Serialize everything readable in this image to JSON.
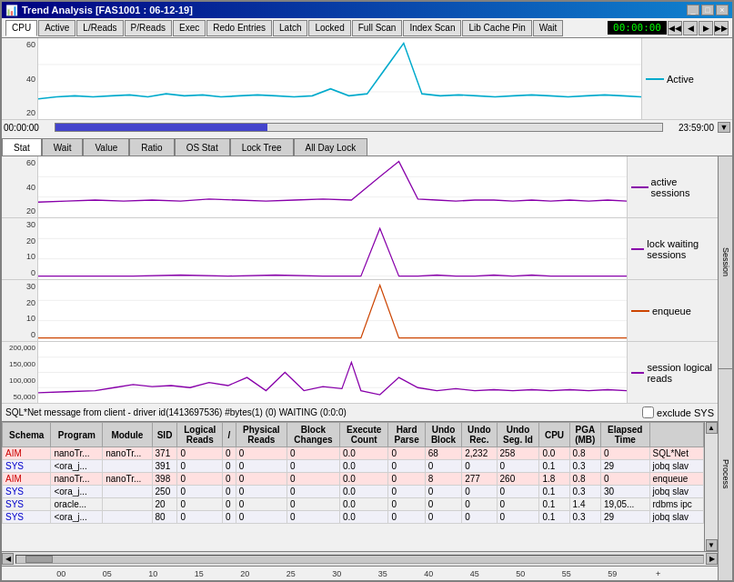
{
  "window": {
    "title": "Trend Analysis [FAS1001 : 06-12-19]",
    "title_icon": "chart-icon"
  },
  "toolbar": {
    "tabs": [
      {
        "label": "CPU",
        "active": true
      },
      {
        "label": "Active",
        "active": false
      },
      {
        "label": "L/Reads",
        "active": false
      },
      {
        "label": "P/Reads",
        "active": false
      },
      {
        "label": "Exec",
        "active": false
      },
      {
        "label": "Redo Entries",
        "active": false
      },
      {
        "label": "Latch",
        "active": false
      },
      {
        "label": "Locked",
        "active": false
      },
      {
        "label": "Full Scan",
        "active": false
      },
      {
        "label": "Index Scan",
        "active": false
      },
      {
        "label": "Lib Cache Pin",
        "active": false
      },
      {
        "label": "Wait",
        "active": false
      }
    ],
    "timer": "00:00:00"
  },
  "progress": {
    "start": "00:00:00",
    "end": "23:59:00"
  },
  "chart_tabs": [
    {
      "label": "Stat",
      "active": true
    },
    {
      "label": "Wait",
      "active": false
    },
    {
      "label": "Value",
      "active": false
    },
    {
      "label": "Ratio",
      "active": false
    },
    {
      "label": "OS Stat",
      "active": false
    },
    {
      "label": "Lock Tree",
      "active": false
    },
    {
      "label": "All Day Lock",
      "active": false
    }
  ],
  "charts": {
    "active": {
      "legend": "Active",
      "color": "#00aacc",
      "y_labels": [
        "60",
        "40",
        "20"
      ]
    },
    "active_sessions": {
      "legend": "active sessions",
      "color": "#8800aa",
      "y_labels": [
        "60",
        "40",
        "20"
      ]
    },
    "lock_waiting": {
      "legend": "lock waiting sessions",
      "color": "#8800aa",
      "y_labels": [
        "30",
        "20",
        "10",
        "0"
      ]
    },
    "enqueue": {
      "legend": "enqueue",
      "color": "#cc4400",
      "y_labels": [
        "30",
        "20",
        "10",
        "0"
      ]
    },
    "session_logical": {
      "legend": "session logical reads",
      "color": "#8800aa",
      "y_labels": [
        "200,000",
        "150,000",
        "100,000",
        "50,000"
      ]
    }
  },
  "session_bar": {
    "text": "SQL*Net message from client - driver id(1413697536) #bytes(1) (0) WAITING (0:0:0)",
    "exclude_sys_label": "exclude SYS"
  },
  "table": {
    "columns": [
      "Schema",
      "Program",
      "Module",
      "SID",
      "Logical Reads",
      "/",
      "Physical Reads",
      "Block Changes",
      "Execute Count",
      "Hard Parse",
      "Undo Block",
      "Undo Rec.",
      "Undo Seg. Id",
      "CPU",
      "PGA (MB)",
      "Elapsed Time",
      ""
    ],
    "rows": [
      {
        "schema": "AIM",
        "program": "nanoTr...",
        "module": "nanoTr...",
        "sid": "371",
        "logical_reads": "0",
        "slash": "0",
        "physical_reads": "0",
        "block_changes": "0",
        "execute_count": "0.0",
        "hard_parse": "0",
        "undo_block": "68",
        "undo_rec": "2,232",
        "undo_seg": "258",
        "cpu": "0.0",
        "pga": "0.8",
        "elapsed": "0",
        "extra": "SQL*Net",
        "type": "aim"
      },
      {
        "schema": "SYS",
        "program": "<ora_j...",
        "module": "",
        "sid": "391",
        "logical_reads": "0",
        "slash": "0",
        "physical_reads": "0",
        "block_changes": "0",
        "execute_count": "0.0",
        "hard_parse": "0",
        "undo_block": "0",
        "undo_rec": "0",
        "undo_seg": "0",
        "cpu": "0.1",
        "pga": "0.3",
        "elapsed": "29",
        "extra": "jobq slav",
        "type": "sys"
      },
      {
        "schema": "AIM",
        "program": "nanoTr...",
        "module": "nanoTr...",
        "sid": "398",
        "logical_reads": "0",
        "slash": "0",
        "physical_reads": "0",
        "block_changes": "0",
        "execute_count": "0.0",
        "hard_parse": "0",
        "undo_block": "8",
        "undo_rec": "277",
        "undo_seg": "260",
        "cpu": "1.8",
        "pga": "0.8",
        "elapsed": "0",
        "extra": "enqueue",
        "type": "aim"
      },
      {
        "schema": "SYS",
        "program": "<ora_j...",
        "module": "",
        "sid": "250",
        "logical_reads": "0",
        "slash": "0",
        "physical_reads": "0",
        "block_changes": "0",
        "execute_count": "0.0",
        "hard_parse": "0",
        "undo_block": "0",
        "undo_rec": "0",
        "undo_seg": "0",
        "cpu": "0.1",
        "pga": "0.3",
        "elapsed": "30",
        "extra": "jobq slav",
        "type": "sys"
      },
      {
        "schema": "SYS",
        "program": "oracle...",
        "module": "",
        "sid": "20",
        "logical_reads": "0",
        "slash": "0",
        "physical_reads": "0",
        "block_changes": "0",
        "execute_count": "0.0",
        "hard_parse": "0",
        "undo_block": "0",
        "undo_rec": "0",
        "undo_seg": "0",
        "cpu": "0.1",
        "pga": "1.4",
        "elapsed": "19,05...",
        "extra": "rdbms ipc",
        "type": "sys"
      },
      {
        "schema": "SYS",
        "program": "<ora_j...",
        "module": "",
        "sid": "80",
        "logical_reads": "0",
        "slash": "0",
        "physical_reads": "0",
        "block_changes": "0",
        "execute_count": "0.0",
        "hard_parse": "0",
        "undo_block": "0",
        "undo_rec": "0",
        "undo_seg": "0",
        "cpu": "0.1",
        "pga": "0.3",
        "elapsed": "29",
        "extra": "jobq slav",
        "type": "sys"
      }
    ]
  },
  "time_ruler": {
    "ticks": [
      "00",
      "05",
      "10",
      "15",
      "20",
      "25",
      "30",
      "35",
      "40",
      "45",
      "50",
      "55",
      "59",
      "+"
    ]
  },
  "right_panel": {
    "labels": [
      "Session",
      "Process"
    ]
  },
  "bottom_scroll": {
    "left_btn": "◀",
    "right_btn": "▶"
  }
}
